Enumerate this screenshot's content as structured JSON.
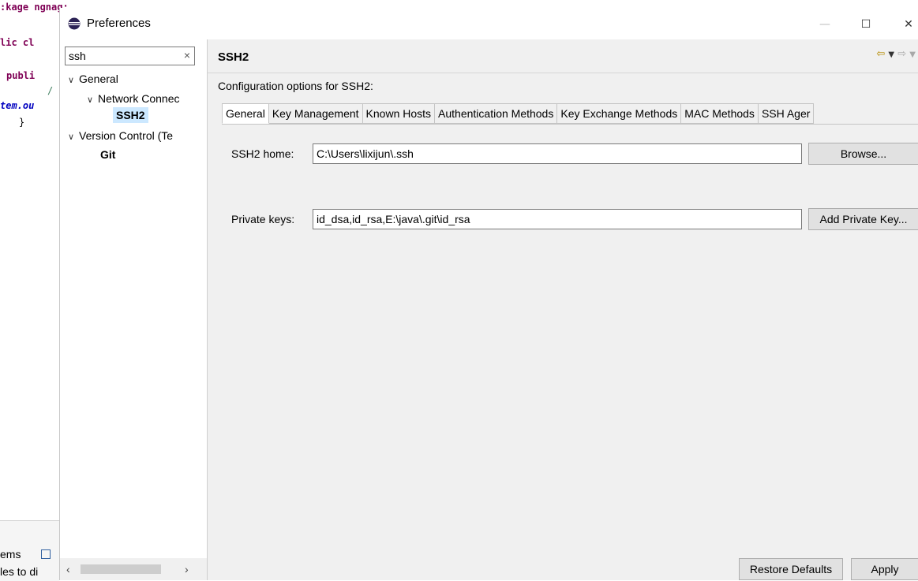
{
  "background_editor": {
    "lines": [
      ":kage ngnag;",
      "lic cl",
      "publi",
      "/",
      "tem.ou",
      "}"
    ],
    "bottom_tab": "ems",
    "bottom_text": "les to di"
  },
  "window": {
    "title": "Preferences",
    "minimize": "—",
    "maximize": "☐",
    "close": "✕"
  },
  "left": {
    "filter_value": "ssh",
    "filter_clear": "×",
    "tree": {
      "general": "General",
      "network": "Network Connec",
      "ssh2": "SSH2",
      "version_control": "Version Control (Te",
      "git": "Git"
    },
    "scroll_left": "‹",
    "scroll_right": "›"
  },
  "right": {
    "title": "SSH2",
    "description": "Configuration options for SSH2:",
    "tabs": [
      "General",
      "Key Management",
      "Known Hosts",
      "Authentication Methods",
      "Key Exchange Methods",
      "MAC Methods",
      "SSH Ager"
    ],
    "ssh2_home_label": "SSH2 home:",
    "ssh2_home_value": "C:\\Users\\lixijun\\.ssh",
    "browse": "Browse...",
    "private_keys_label": "Private keys:",
    "private_keys_value": "id_dsa,id_rsa,E:\\java\\.git\\id_rsa",
    "add_private_key": "Add Private Key...",
    "restore_defaults": "Restore Defaults",
    "apply": "Apply"
  },
  "icons": {
    "app": "eclipse-icon",
    "back": "back-arrow-icon",
    "forward": "forward-arrow-icon"
  }
}
